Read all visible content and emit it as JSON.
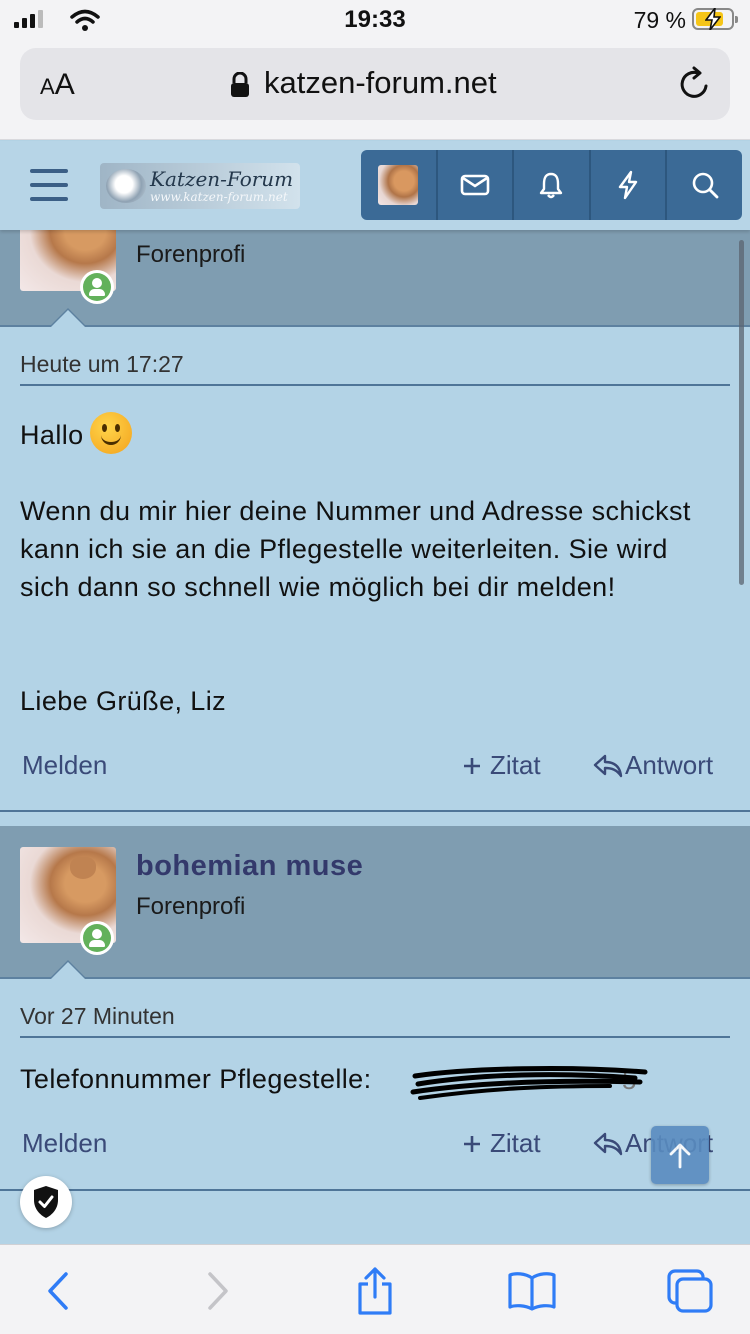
{
  "status_bar": {
    "time": "19:33",
    "battery_percent": "79 %",
    "battery_level": 0.79,
    "charging": true
  },
  "browser": {
    "text_size_label_small": "A",
    "text_size_label_large": "A",
    "url": "katzen-forum.net"
  },
  "forum_header": {
    "logo_title": "Katzen-Forum",
    "logo_subtitle": "www.katzen-forum.net",
    "icons": [
      "account-avatar",
      "inbox-icon",
      "alerts-bell-icon",
      "whats-new-bolt-icon",
      "search-icon"
    ]
  },
  "posts": [
    {
      "user_role": "Forenprofi",
      "date": "Heute um 17:27",
      "greeting": "Hallo",
      "body": "Wenn du mir hier deine Nummer und Adresse schickst kann ich sie an die Pflegestelle weiterleiten. Sie wird sich dann so schnell wie möglich bei dir melden!",
      "signoff": "Liebe Grüße, Liz",
      "actions": {
        "report": "Melden",
        "quote": "Zitat",
        "reply": "Antwort"
      }
    },
    {
      "username": "bohemian muse",
      "user_role": "Forenprofi",
      "date": "Vor 27 Minuten",
      "body": "Telefonnummer Pflegestelle:",
      "redacted_visible_tail": "5",
      "actions": {
        "report": "Melden",
        "quote": "Zitat",
        "reply": "Antwort"
      }
    }
  ],
  "colors": {
    "page_bg": "#b3d3e6",
    "user_band": "#7f9db1",
    "nav_buttons": "#3b6a96",
    "username": "#33396b",
    "action_text": "#3a4a78",
    "ios_blue": "#2f7cf6"
  },
  "toolbar_icons": [
    "back-icon",
    "forward-icon",
    "share-icon",
    "bookmarks-icon",
    "tabs-icon"
  ]
}
